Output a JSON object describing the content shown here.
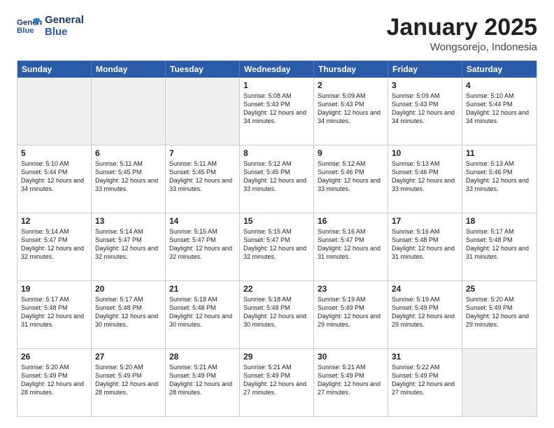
{
  "logo": {
    "line1": "General",
    "line2": "Blue"
  },
  "title": "January 2025",
  "subtitle": "Wongsorejo, Indonesia",
  "dayHeaders": [
    "Sunday",
    "Monday",
    "Tuesday",
    "Wednesday",
    "Thursday",
    "Friday",
    "Saturday"
  ],
  "weeks": [
    [
      {
        "day": "",
        "info": "",
        "shaded": true
      },
      {
        "day": "",
        "info": "",
        "shaded": true
      },
      {
        "day": "",
        "info": "",
        "shaded": true
      },
      {
        "day": "1",
        "info": "Sunrise: 5:08 AM\nSunset: 5:43 PM\nDaylight: 12 hours\nand 34 minutes.",
        "shaded": false
      },
      {
        "day": "2",
        "info": "Sunrise: 5:09 AM\nSunset: 5:43 PM\nDaylight: 12 hours\nand 34 minutes.",
        "shaded": false
      },
      {
        "day": "3",
        "info": "Sunrise: 5:09 AM\nSunset: 5:43 PM\nDaylight: 12 hours\nand 34 minutes.",
        "shaded": false
      },
      {
        "day": "4",
        "info": "Sunrise: 5:10 AM\nSunset: 5:44 PM\nDaylight: 12 hours\nand 34 minutes.",
        "shaded": false
      }
    ],
    [
      {
        "day": "5",
        "info": "Sunrise: 5:10 AM\nSunset: 5:44 PM\nDaylight: 12 hours\nand 34 minutes.",
        "shaded": false
      },
      {
        "day": "6",
        "info": "Sunrise: 5:11 AM\nSunset: 5:45 PM\nDaylight: 12 hours\nand 33 minutes.",
        "shaded": false
      },
      {
        "day": "7",
        "info": "Sunrise: 5:11 AM\nSunset: 5:45 PM\nDaylight: 12 hours\nand 33 minutes.",
        "shaded": false
      },
      {
        "day": "8",
        "info": "Sunrise: 5:12 AM\nSunset: 5:45 PM\nDaylight: 12 hours\nand 33 minutes.",
        "shaded": false
      },
      {
        "day": "9",
        "info": "Sunrise: 5:12 AM\nSunset: 5:46 PM\nDaylight: 12 hours\nand 33 minutes.",
        "shaded": false
      },
      {
        "day": "10",
        "info": "Sunrise: 5:13 AM\nSunset: 5:46 PM\nDaylight: 12 hours\nand 33 minutes.",
        "shaded": false
      },
      {
        "day": "11",
        "info": "Sunrise: 5:13 AM\nSunset: 5:46 PM\nDaylight: 12 hours\nand 33 minutes.",
        "shaded": false
      }
    ],
    [
      {
        "day": "12",
        "info": "Sunrise: 5:14 AM\nSunset: 5:47 PM\nDaylight: 12 hours\nand 32 minutes.",
        "shaded": false
      },
      {
        "day": "13",
        "info": "Sunrise: 5:14 AM\nSunset: 5:47 PM\nDaylight: 12 hours\nand 32 minutes.",
        "shaded": false
      },
      {
        "day": "14",
        "info": "Sunrise: 5:15 AM\nSunset: 5:47 PM\nDaylight: 12 hours\nand 32 minutes.",
        "shaded": false
      },
      {
        "day": "15",
        "info": "Sunrise: 5:15 AM\nSunset: 5:47 PM\nDaylight: 12 hours\nand 32 minutes.",
        "shaded": false
      },
      {
        "day": "16",
        "info": "Sunrise: 5:16 AM\nSunset: 5:47 PM\nDaylight: 12 hours\nand 31 minutes.",
        "shaded": false
      },
      {
        "day": "17",
        "info": "Sunrise: 5:16 AM\nSunset: 5:48 PM\nDaylight: 12 hours\nand 31 minutes.",
        "shaded": false
      },
      {
        "day": "18",
        "info": "Sunrise: 5:17 AM\nSunset: 5:48 PM\nDaylight: 12 hours\nand 31 minutes.",
        "shaded": false
      }
    ],
    [
      {
        "day": "19",
        "info": "Sunrise: 5:17 AM\nSunset: 5:48 PM\nDaylight: 12 hours\nand 31 minutes.",
        "shaded": false
      },
      {
        "day": "20",
        "info": "Sunrise: 5:17 AM\nSunset: 5:48 PM\nDaylight: 12 hours\nand 30 minutes.",
        "shaded": false
      },
      {
        "day": "21",
        "info": "Sunrise: 5:18 AM\nSunset: 5:48 PM\nDaylight: 12 hours\nand 30 minutes.",
        "shaded": false
      },
      {
        "day": "22",
        "info": "Sunrise: 5:18 AM\nSunset: 5:48 PM\nDaylight: 12 hours\nand 30 minutes.",
        "shaded": false
      },
      {
        "day": "23",
        "info": "Sunrise: 5:19 AM\nSunset: 5:49 PM\nDaylight: 12 hours\nand 29 minutes.",
        "shaded": false
      },
      {
        "day": "24",
        "info": "Sunrise: 5:19 AM\nSunset: 5:49 PM\nDaylight: 12 hours\nand 29 minutes.",
        "shaded": false
      },
      {
        "day": "25",
        "info": "Sunrise: 5:20 AM\nSunset: 5:49 PM\nDaylight: 12 hours\nand 29 minutes.",
        "shaded": false
      }
    ],
    [
      {
        "day": "26",
        "info": "Sunrise: 5:20 AM\nSunset: 5:49 PM\nDaylight: 12 hours\nand 28 minutes.",
        "shaded": false
      },
      {
        "day": "27",
        "info": "Sunrise: 5:20 AM\nSunset: 5:49 PM\nDaylight: 12 hours\nand 28 minutes.",
        "shaded": false
      },
      {
        "day": "28",
        "info": "Sunrise: 5:21 AM\nSunset: 5:49 PM\nDaylight: 12 hours\nand 28 minutes.",
        "shaded": false
      },
      {
        "day": "29",
        "info": "Sunrise: 5:21 AM\nSunset: 5:49 PM\nDaylight: 12 hours\nand 27 minutes.",
        "shaded": false
      },
      {
        "day": "30",
        "info": "Sunrise: 5:21 AM\nSunset: 5:49 PM\nDaylight: 12 hours\nand 27 minutes.",
        "shaded": false
      },
      {
        "day": "31",
        "info": "Sunrise: 5:22 AM\nSunset: 5:49 PM\nDaylight: 12 hours\nand 27 minutes.",
        "shaded": false
      },
      {
        "day": "",
        "info": "",
        "shaded": true
      }
    ]
  ]
}
